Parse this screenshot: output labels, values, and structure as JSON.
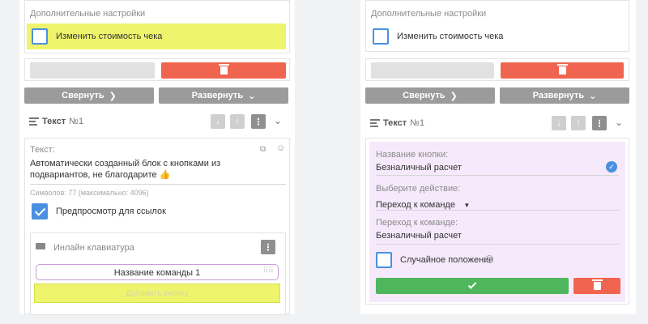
{
  "left": {
    "settings_caption": "Дополнительные настройки",
    "change_price_label": "Изменить стоимость чека",
    "collapse_label": "Свернуть",
    "expand_label": "Развернуть",
    "block_title": "Текст",
    "block_number": "№1",
    "text_caption": "Текст:",
    "text_body": "Автоматически созданный блок с кнопками из подвариантов, не благодарите 👍",
    "chars_counter": "Символов: 77 (максимально: 4096)",
    "preview_links_label": "Предпросмотр для ссылок",
    "inline_keyboard_label": "Инлайн клавиатура",
    "command_name": "Название команды 1",
    "add_button_label": "Добавить кнопку"
  },
  "right": {
    "settings_caption": "Дополнительные настройки",
    "change_price_label": "Изменить стоимость чека",
    "collapse_label": "Свернуть",
    "expand_label": "Развернуть",
    "block_title": "Текст",
    "block_number": "№1",
    "button_name_caption": "Название кнопки:",
    "button_name_value": "Безналичный расчет",
    "choose_action_caption": "Выберите действие:",
    "choose_action_value": "Переход к команде",
    "goto_command_caption": "Переход к команде:",
    "goto_command_value": "Безналичный расчет",
    "random_position_label": "Случайное положение"
  },
  "colors": {
    "accent_blue": "#4a90e2",
    "delete_red": "#f0654f",
    "confirm_green": "#4fb65e",
    "highlight_yellow": "#eef46c",
    "edit_panel_pink": "#f6e9fb"
  }
}
